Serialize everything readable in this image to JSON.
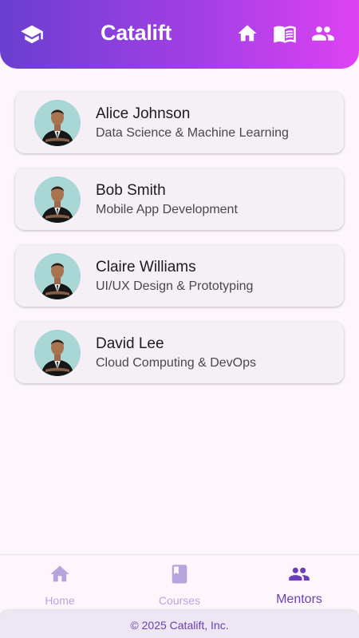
{
  "appbar": {
    "title": "Catalift",
    "logo_icon": "graduation-cap-icon",
    "actions": [
      {
        "icon": "home-icon"
      },
      {
        "icon": "book-icon"
      },
      {
        "icon": "people-icon"
      }
    ],
    "gradient": [
      "#6a3fd0",
      "#de42f3"
    ]
  },
  "mentors": [
    {
      "name": "Alice Johnson",
      "role": "Data Science & Machine Learning"
    },
    {
      "name": "Bob Smith",
      "role": "Mobile App Development"
    },
    {
      "name": "Claire Williams",
      "role": "UI/UX Design & Prototyping"
    },
    {
      "name": "David Lee",
      "role": "Cloud Computing & DevOps"
    }
  ],
  "bottom_nav": {
    "items": [
      {
        "label": "Home",
        "icon": "home-icon"
      },
      {
        "label": "Courses",
        "icon": "book-icon"
      },
      {
        "label": "Mentors",
        "icon": "people-icon"
      }
    ],
    "active": "Mentors"
  },
  "footer": {
    "text": "© 2025 Catalift, Inc."
  },
  "colors": {
    "accent": "#6a3fb7",
    "background": "#fdf7fd",
    "card": "#f5f0f6"
  }
}
